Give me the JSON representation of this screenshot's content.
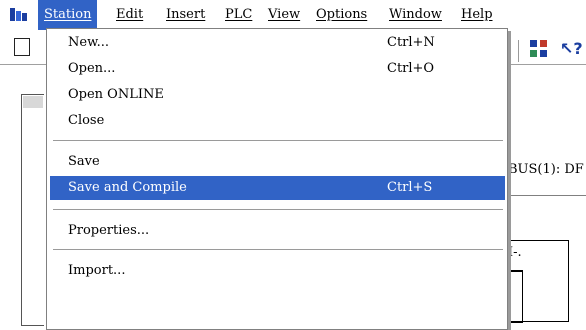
{
  "menubar": {
    "items": [
      "Station",
      "Edit",
      "Insert",
      "PLC",
      "View",
      "Options",
      "Window",
      "Help"
    ],
    "active": "Station"
  },
  "background": {
    "bus_text": "BUS(1): DF",
    "box_label": "I-."
  },
  "station_menu": {
    "items": [
      {
        "label": "New...",
        "shortcut": "Ctrl+N"
      },
      {
        "label": "Open...",
        "shortcut": "Ctrl+O"
      },
      {
        "label": "Open ONLINE",
        "shortcut": ""
      },
      {
        "label": "Close",
        "shortcut": ""
      },
      {
        "label": "Save",
        "shortcut": ""
      },
      {
        "label": "Save and Compile",
        "shortcut": "Ctrl+S",
        "highlighted": true
      },
      {
        "label": "Properties...",
        "shortcut": ""
      },
      {
        "label": "Import...",
        "shortcut": ""
      }
    ]
  },
  "colors": {
    "highlight": "#3163c6",
    "highlight_text": "#ffffff"
  }
}
